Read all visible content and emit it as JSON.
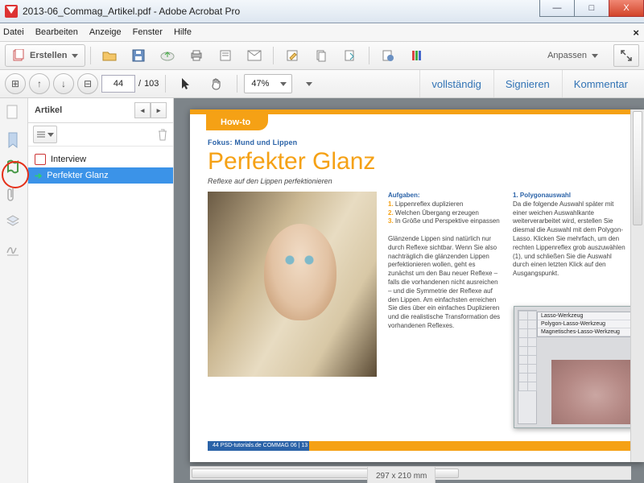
{
  "window": {
    "title": "2013-06_Commag_Artikel.pdf - Adobe Acrobat Pro"
  },
  "menu": {
    "items": [
      "Datei",
      "Bearbeiten",
      "Anzeige",
      "Fenster",
      "Hilfe"
    ]
  },
  "toolbar": {
    "create": "Erstellen",
    "customize": "Anpassen"
  },
  "nav": {
    "page": "44",
    "total": "103",
    "zoom": "47%"
  },
  "rightlinks": {
    "full": "vollständig",
    "sign": "Signieren",
    "comment": "Kommentar"
  },
  "panel": {
    "title": "Artikel",
    "items": [
      {
        "label": "Interview",
        "selected": false
      },
      {
        "label": "Perfekter Glanz",
        "selected": true
      }
    ]
  },
  "doc": {
    "tab": "How-to",
    "fokus": "Fokus: Mund und Lippen",
    "h1": "Perfekter Glanz",
    "sub": "Reflexe auf den Lippen perfektionieren",
    "tasks_h": "Aufgaben:",
    "tasks": [
      "Lippenreflex duplizieren",
      "Welchen Übergang erzeugen",
      "In Größe und Perspektive einpassen"
    ],
    "para": "Glänzende Lippen sind natürlich nur durch Reflexe sichtbar. Wenn Sie also nachträglich die glänzenden Lippen perfektionieren wollen, geht es zunächst um den Bau neuer Reflexe – falls die vorhandenen nicht ausreichen – und die Symmetrie der Reflexe auf den Lippen. Am einfachsten erreichen Sie dies über ein einfaches Duplizieren und die realistische Transformation des vorhandenen Reflexes.",
    "col2_h": "1. Polygonauswahl",
    "col2": "Da die folgende Auswahl später mit einer weichen Auswahlkante weiterverarbeitet wird, erstellen Sie diesmal die Auswahl mit dem Polygon-Lasso. Klicken Sie mehrfach, um den rechten Lippenreflex grob auszuwählen (1), und schließen Sie die Auswahl durch einen letzten Klick auf den Ausgangspunkt.",
    "tool_menu": [
      "Lasso-Werkzeug",
      "Polygon-Lasso-Werkzeug",
      "Magnetisches-Lasso-Werkzeug"
    ],
    "footer_blue": "44    PSD-tutorials.de   COMMAG 06 | 13"
  },
  "status": {
    "dims": "297 x 210 mm"
  }
}
